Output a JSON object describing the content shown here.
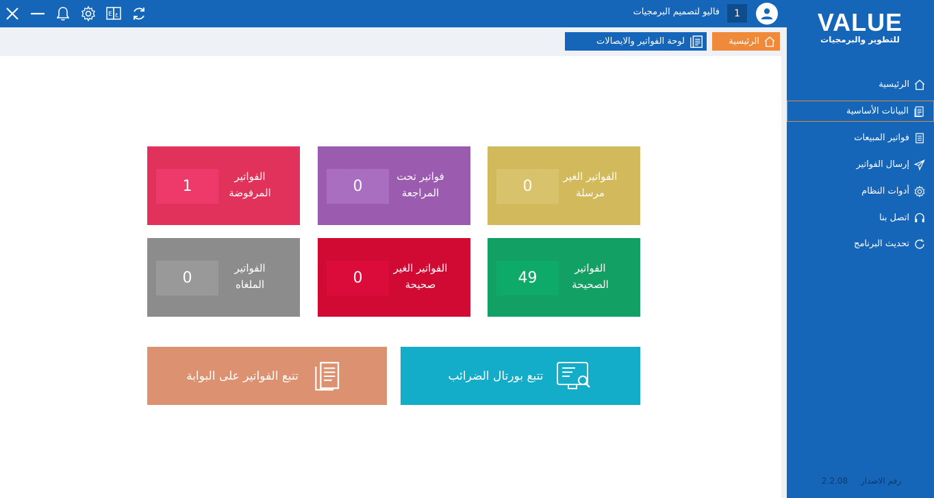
{
  "colors": {
    "brand_blue": "#1565b8",
    "home_tab": "#ef8a3a",
    "tile_rejected": "#e0325a",
    "tile_review": "#9b5caf",
    "tile_unsent": "#d1b95c",
    "tile_cancelled": "#8c8c8c",
    "tile_invalid": "#d10a33",
    "tile_valid": "#12a065",
    "track_gateway": "#dc9170",
    "track_portal": "#14adc9"
  },
  "topbar": {
    "icons": [
      "close-icon",
      "minimize-icon",
      "bell-icon",
      "gear-icon",
      "language-icon",
      "refresh-icon"
    ],
    "user_name": "فاليو لتصميم البرمجيات",
    "user_count": "1"
  },
  "sidebar": {
    "logo": "VALUE",
    "logo_subtitle": "للتطوير والبرمجيات",
    "items": [
      {
        "label": "الرئيسية",
        "icon": "home-icon"
      },
      {
        "label": "البيانات الأساسية",
        "icon": "document-icon"
      },
      {
        "label": "فواتير المبيعات",
        "icon": "invoice-icon"
      },
      {
        "label": "إرسال الفواتير",
        "icon": "send-icon"
      },
      {
        "label": "أدوات النظام",
        "icon": "gear-icon"
      },
      {
        "label": "اتصل بنا",
        "icon": "headset-icon"
      },
      {
        "label": "تحديث البرنامج",
        "icon": "refresh-icon"
      }
    ],
    "version_label": "رقم الاصدار",
    "version": "2.2.08"
  },
  "tabs": {
    "home": "الرئيسية",
    "dashboard": "لوحة الفواتير والايصالات"
  },
  "tiles": {
    "rejected": {
      "label_1": "الفواتير",
      "label_2": "المرفوضة",
      "count": "1"
    },
    "under_review": {
      "label_1": "فواتير تحت",
      "label_2": "المراجعة",
      "count": "0"
    },
    "unsent": {
      "label_1": "الفواتير الغير",
      "label_2": "مرسلة",
      "count": "0"
    },
    "cancelled": {
      "label_1": "الفواتير",
      "label_2": "الملغاه",
      "count": "0"
    },
    "invalid": {
      "label_1": "الفواتير الغير",
      "label_2": "صحيحة",
      "count": "0"
    },
    "valid": {
      "label_1": "الفواتير",
      "label_2": "الصحيحة",
      "count": "49"
    }
  },
  "actions": {
    "track_gateway": "تتبع الفواتير على البوابة",
    "track_portal": "تتبع بورتال الضرائب"
  }
}
